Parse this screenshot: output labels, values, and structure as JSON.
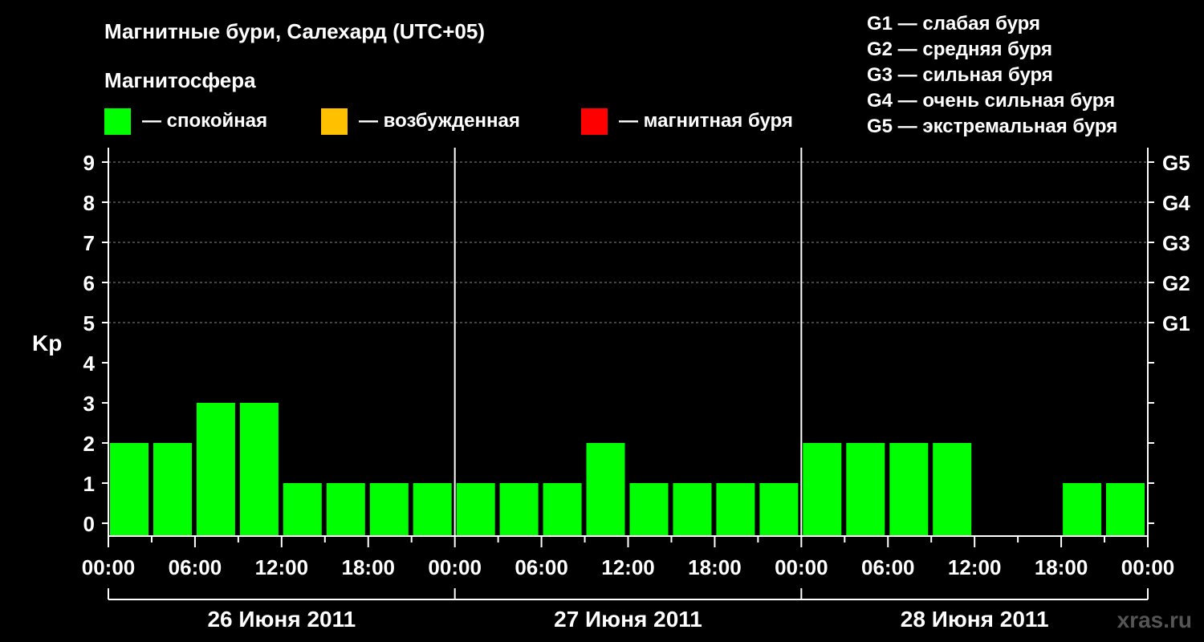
{
  "title": "Магнитные бури, Салехард (UTC+05)",
  "legend": {
    "heading": "Магнитосфера",
    "items": [
      {
        "label": "— спокойная",
        "color": "#00ff00"
      },
      {
        "label": "— возбужденная",
        "color": "#ffc000"
      },
      {
        "label": "— магнитная буря",
        "color": "#ff0000"
      }
    ]
  },
  "storm_scale": [
    "G1 — слабая буря",
    "G2 — средняя буря",
    "G3 — сильная буря",
    "G4 — очень сильная буря",
    "G5 — экстремальная буря"
  ],
  "watermark": "xras.ru",
  "chart_data": {
    "type": "bar",
    "ylabel": "Kp",
    "ylim": [
      0,
      9
    ],
    "yticks": [
      0,
      1,
      2,
      3,
      4,
      5,
      6,
      7,
      8,
      9
    ],
    "right_ticks": [
      {
        "kp": 5,
        "label": "G1"
      },
      {
        "kp": 6,
        "label": "G2"
      },
      {
        "kp": 7,
        "label": "G3"
      },
      {
        "kp": 8,
        "label": "G4"
      },
      {
        "kp": 9,
        "label": "G5"
      }
    ],
    "xtick_labels": [
      "00:00",
      "06:00",
      "12:00",
      "18:00",
      "00:00",
      "06:00",
      "12:00",
      "18:00",
      "00:00",
      "06:00",
      "12:00",
      "18:00",
      "00:00"
    ],
    "days": [
      "26 Июня 2011",
      "27 Июня 2011",
      "28 Июня 2011"
    ],
    "bar_color": "#00ff00",
    "grid": "dashed at Kp 5-9",
    "values": [
      2,
      2,
      3,
      3,
      1,
      1,
      1,
      1,
      1,
      1,
      1,
      2,
      1,
      1,
      1,
      1,
      2,
      2,
      2,
      2,
      null,
      null,
      1,
      1
    ]
  }
}
